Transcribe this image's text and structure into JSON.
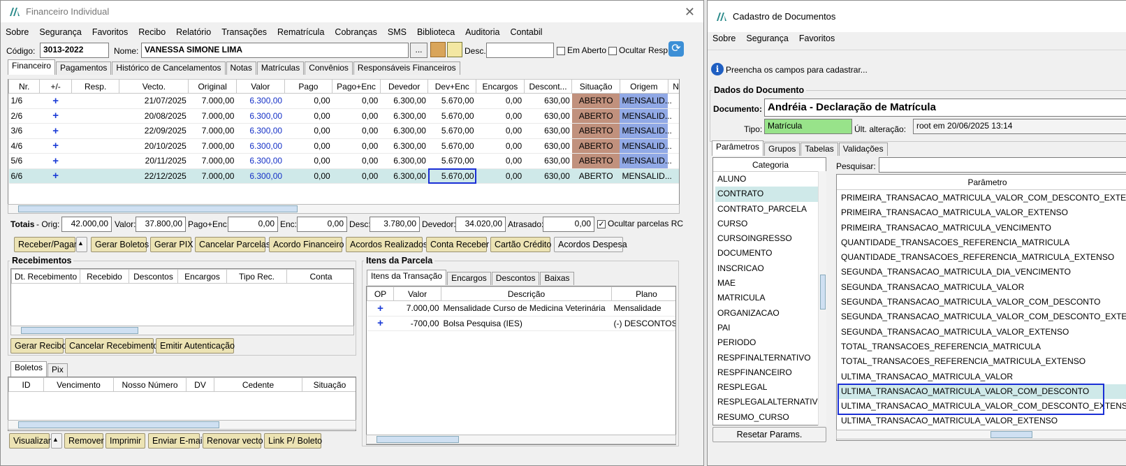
{
  "w1": {
    "title": "Financeiro Individual",
    "menu": [
      "Sobre",
      "Segurança",
      "Favoritos",
      "Recibo",
      "Relatório",
      "Transações",
      "Rematrícula",
      "Cobranças",
      "SMS",
      "Biblioteca",
      "Auditoria",
      "Contabil"
    ],
    "codigo_label": "Código:",
    "codigo": "3013-2022",
    "nome_label": "Nome:",
    "nome": "VANESSA SIMONE LIMA",
    "ellipsis": "...",
    "desc_label": "Desc.:",
    "desc": "",
    "em_aberto": "Em Aberto",
    "ocultar_resp": "Ocultar Resp.",
    "tabs": [
      "Financeiro",
      "Pagamentos",
      "Histórico de Cancelamentos",
      "Notas",
      "Matrículas",
      "Convênios",
      "Responsáveis Financeiros"
    ],
    "columns": [
      "Nr.",
      "+/-",
      "Resp.",
      "Vecto.",
      "Original",
      "Valor",
      "Pago",
      "Pago+Enc",
      "Devedor",
      "Dev+Enc",
      "Encargos",
      "Descont...",
      "Situação",
      "Origem",
      "NF"
    ],
    "rows": [
      {
        "nr": "1/6",
        "pm": "+",
        "resp": "",
        "vecto": "21/07/2025",
        "original": "7.000,00",
        "valor": "6.300,00",
        "pago": "0,00",
        "pagoenc": "0,00",
        "devedor": "6.300,00",
        "devenc": "5.670,00",
        "encargos": "0,00",
        "desconto": "630,00",
        "situacao": "ABERTO",
        "origem": "MENSALID..."
      },
      {
        "nr": "2/6",
        "pm": "+",
        "resp": "",
        "vecto": "20/08/2025",
        "original": "7.000,00",
        "valor": "6.300,00",
        "pago": "0,00",
        "pagoenc": "0,00",
        "devedor": "6.300,00",
        "devenc": "5.670,00",
        "encargos": "0,00",
        "desconto": "630,00",
        "situacao": "ABERTO",
        "origem": "MENSALID..."
      },
      {
        "nr": "3/6",
        "pm": "+",
        "resp": "",
        "vecto": "22/09/2025",
        "original": "7.000,00",
        "valor": "6.300,00",
        "pago": "0,00",
        "pagoenc": "0,00",
        "devedor": "6.300,00",
        "devenc": "5.670,00",
        "encargos": "0,00",
        "desconto": "630,00",
        "situacao": "ABERTO",
        "origem": "MENSALID..."
      },
      {
        "nr": "4/6",
        "pm": "+",
        "resp": "",
        "vecto": "20/10/2025",
        "original": "7.000,00",
        "valor": "6.300,00",
        "pago": "0,00",
        "pagoenc": "0,00",
        "devedor": "6.300,00",
        "devenc": "5.670,00",
        "encargos": "0,00",
        "desconto": "630,00",
        "situacao": "ABERTO",
        "origem": "MENSALID..."
      },
      {
        "nr": "5/6",
        "pm": "+",
        "resp": "",
        "vecto": "20/11/2025",
        "original": "7.000,00",
        "valor": "6.300,00",
        "pago": "0,00",
        "pagoenc": "0,00",
        "devedor": "6.300,00",
        "devenc": "5.670,00",
        "encargos": "0,00",
        "desconto": "630,00",
        "situacao": "ABERTO",
        "origem": "MENSALID..."
      },
      {
        "nr": "6/6",
        "pm": "+",
        "resp": "",
        "vecto": "22/12/2025",
        "original": "7.000,00",
        "valor": "6.300,00",
        "pago": "0,00",
        "pagoenc": "0,00",
        "devedor": "6.300,00",
        "devenc": "5.670,00",
        "encargos": "0,00",
        "desconto": "630,00",
        "situacao": "ABERTO",
        "origem": "MENSALID..."
      }
    ],
    "totais": {
      "label": "Totais",
      "orig_label": "- Orig:",
      "orig": "42.000,00",
      "valor_label": "Valor:",
      "valor": "37.800,00",
      "pagoenc_label": "Pago+Enc:",
      "pagoenc": "0,00",
      "enc_label": "Enc:",
      "enc": "0,00",
      "desc_label": "Desc:",
      "desc": "3.780,00",
      "devedor_label": "Devedor:",
      "devedor": "34.020,00",
      "atrasado_label": "Atrasado:",
      "atrasado": "0,00",
      "ocultar": "Ocultar parcelas RC"
    },
    "buttons": [
      "Receber/Pagar",
      "Gerar Boletos",
      "Gerar PIX",
      "Cancelar Parcelas",
      "Acordo Financeiro",
      "Acordos Realizados",
      "Conta Receber",
      "Cartão Crédito",
      "Acordos Despesa"
    ],
    "receb": {
      "title": "Recebimentos",
      "columns": [
        "Dt. Recebimento",
        "Recebido",
        "Descontos",
        "Encargos",
        "Tipo Rec.",
        "Conta"
      ],
      "buttons": [
        "Gerar Recibo",
        "Cancelar Recebimento",
        "Emitir Autenticação"
      ]
    },
    "itens": {
      "title": "Itens da Parcela",
      "tabs": [
        "Itens da Transação",
        "Encargos",
        "Descontos",
        "Baixas"
      ],
      "columns": [
        "OP",
        "Valor",
        "Descrição",
        "Plano"
      ],
      "rows": [
        {
          "op": "+",
          "valor": "7.000,00",
          "desc": "Mensalidade Curso de Medicina Veterinária",
          "plano": "Mensalidade"
        },
        {
          "op": "+",
          "valor": "-700,00",
          "desc": "Bolsa Pesquisa (IES)",
          "plano": "(-) DESCONTOS D"
        }
      ]
    },
    "boletos": {
      "tabs": [
        "Boletos",
        "Pix"
      ],
      "columns": [
        "ID",
        "Vencimento",
        "Nosso Número",
        "DV",
        "Cedente",
        "Situação"
      ],
      "buttons": [
        "Visualizar",
        "Remover",
        "Imprimir",
        "Enviar E-mail",
        "Renovar vecto",
        "Link P/ Boleto"
      ]
    }
  },
  "w2": {
    "title": "Cadastro de Documentos",
    "menu": [
      "Sobre",
      "Segurança",
      "Favoritos"
    ],
    "info": "Preencha os campos para cadastrar...",
    "group": "Dados do Documento",
    "doc_label": "Documento:",
    "doc": "Andréia - Declaração de Matrícula",
    "tipo_label": "Tipo:",
    "tipo": "Matrícula",
    "ult_label": "Últ. alteração:",
    "ult": "root em 20/06/2025 13:14",
    "tabs": [
      "Parâmetros",
      "Grupos",
      "Tabelas",
      "Validações"
    ],
    "cat_header": "Categoria",
    "pesquisar": "Pesquisar:",
    "param_header": "Parâmetro",
    "categorias": [
      "ALUNO",
      "CONTRATO",
      "CONTRATO_PARCELA",
      "CURSO",
      "CURSOINGRESSO",
      "DOCUMENTO",
      "INSCRICAO",
      "MAE",
      "MATRICULA",
      "ORGANIZACAO",
      "PAI",
      "PERIODO",
      "RESPFINALTERNATIVO",
      "RESPFINANCEIRO",
      "RESPLEGAL",
      "RESPLEGALALTERNATIVO",
      "RESUMO_CURSO"
    ],
    "parametros": [
      "PRIMEIRA_TRANSACAO_MATRICULA_VALOR_COM_DESCONTO_EXTENSO",
      "PRIMEIRA_TRANSACAO_MATRICULA_VALOR_EXTENSO",
      "PRIMEIRA_TRANSACAO_MATRICULA_VENCIMENTO",
      "QUANTIDADE_TRANSACOES_REFERENCIA_MATRICULA",
      "QUANTIDADE_TRANSACOES_REFERENCIA_MATRICULA_EXTENSO",
      "SEGUNDA_TRANSACAO_MATRICULA_DIA_VENCIMENTO",
      "SEGUNDA_TRANSACAO_MATRICULA_VALOR",
      "SEGUNDA_TRANSACAO_MATRICULA_VALOR_COM_DESCONTO",
      "SEGUNDA_TRANSACAO_MATRICULA_VALOR_COM_DESCONTO_EXTENSO",
      "SEGUNDA_TRANSACAO_MATRICULA_VALOR_EXTENSO",
      "TOTAL_TRANSACOES_REFERENCIA_MATRICULA",
      "TOTAL_TRANSACOES_REFERENCIA_MATRICULA_EXTENSO",
      "ULTIMA_TRANSACAO_MATRICULA_VALOR",
      "ULTIMA_TRANSACAO_MATRICULA_VALOR_COM_DESCONTO",
      "ULTIMA_TRANSACAO_MATRICULA_VALOR_COM_DESCONTO_EXTENSO",
      "ULTIMA_TRANSACAO_MATRICULA_VALOR_EXTENSO"
    ],
    "resetar": "Resetar Params."
  }
}
